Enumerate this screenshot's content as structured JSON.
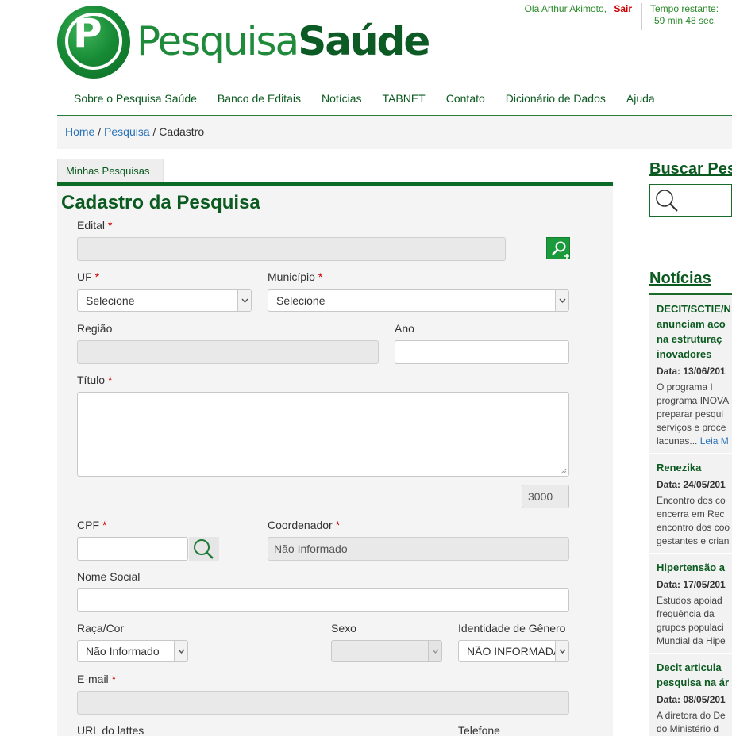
{
  "header": {
    "logo_part1": "Pesquisa",
    "logo_part2": "Saúde",
    "logo_letter": "P",
    "greeting": "Olá Arthur Akimoto,",
    "logout": "Sair",
    "timer_label": "Tempo restante:",
    "timer_value": "59 min 48 sec."
  },
  "nav": [
    "Sobre o Pesquisa Saúde",
    "Banco de Editais",
    "Notícias",
    "TABNET",
    "Contato",
    "Dicionário de Dados",
    "Ajuda"
  ],
  "breadcrumb": {
    "home": "Home",
    "sep1": " / ",
    "pesquisa": "Pesquisa",
    "sep2": " / ",
    "current": "Cadastro"
  },
  "tab": "Minhas Pesquisas",
  "form": {
    "title": "Cadastro da Pesquisa",
    "required_mark": "*",
    "edital_label": "Edital",
    "edital_value": "",
    "uf_label": "UF",
    "uf_value": "Selecione",
    "municipio_label": "Município",
    "municipio_value": "Selecione",
    "regiao_label": "Região",
    "regiao_value": "",
    "ano_label": "Ano",
    "ano_value": "",
    "titulo_label": "Título",
    "titulo_value": "",
    "titulo_counter": "3000",
    "cpf_label": "CPF",
    "cpf_value": "",
    "coordenador_label": "Coordenador",
    "coordenador_value": "Não Informado",
    "nome_social_label": "Nome Social",
    "nome_social_value": "",
    "raca_label": "Raça/Cor",
    "raca_value": "Não Informado",
    "sexo_label": "Sexo",
    "sexo_value": "",
    "genero_label": "Identidade de Gênero",
    "genero_value": "NÃO INFORMADA",
    "email_label": "E-mail",
    "email_value": "",
    "lattes_label": "URL do lattes",
    "telefone_label": "Telefone"
  },
  "sidebar": {
    "search_title": "Buscar Pes",
    "news_title": "Notícias",
    "news": [
      {
        "title_lines": [
          "DECIT/SCTIE/N",
          "anunciam aco",
          "na estruturaç",
          "inovadores"
        ],
        "date": "Data: 13/06/201",
        "body_lines": [
          "O programa I",
          "programa INOVA",
          "preparar pesqui",
          "serviços e proce",
          "lacunas..."
        ],
        "more": "Leia M"
      },
      {
        "title_lines": [
          "Renezika"
        ],
        "date": "Data: 24/05/201",
        "body_lines": [
          "Encontro dos co",
          "encerra em Rec",
          "encontro dos coo",
          "gestantes e crian"
        ],
        "more": ""
      },
      {
        "title_lines": [
          "Hipertensão a"
        ],
        "date": "Data: 17/05/201",
        "body_lines": [
          "Estudos apoiad",
          "frequência da",
          "grupos populaci",
          "Mundial da Hipe"
        ],
        "more": ""
      },
      {
        "title_lines": [
          "Decit articula",
          "pesquisa na ár"
        ],
        "date": "Data: 08/05/201",
        "body_lines": [
          "A diretora do De",
          "do Ministério d"
        ],
        "more": ""
      }
    ]
  },
  "colors": {
    "brand_green": "#0b5a20",
    "accent_green": "#1a9a3a",
    "required_red": "#cc0000",
    "link_blue": "#2a73b8"
  }
}
